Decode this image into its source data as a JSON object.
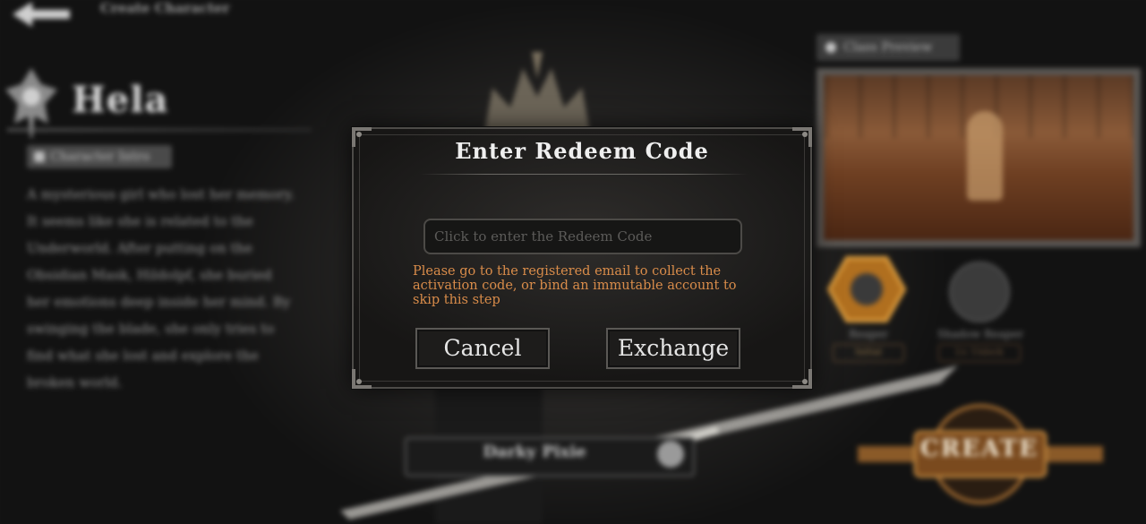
{
  "background": {
    "topbar_title": "Create Character",
    "character_name": "Hela",
    "intro_tab_label": "Character Intro",
    "description": "A mysterious girl who lost her memory. It seems like she is related to the Underworld. After putting on the Obsidian Mask, Hildolpf, she buried her emotions deep inside her mind. By swinging the blade, she only tries to find what she lost and explore the broken world.",
    "preview_tab_label": "Class Preview",
    "skills": [
      {
        "name": "Reaper",
        "tag": "Initial"
      },
      {
        "name": "Shadow Reaper",
        "tag": "Lv. Unlock"
      }
    ],
    "outfit_label": "Darky Pixie",
    "create_label": "CREATE"
  },
  "modal": {
    "title": "Enter Redeem Code",
    "input_placeholder": "Click to enter the Redeem Code",
    "input_value": "",
    "notice": "Please go to the registered email to collect the activation code, or bind an immutable account to skip this step",
    "cancel_label": "Cancel",
    "exchange_label": "Exchange"
  },
  "colors": {
    "notice_text": "#d98c4a",
    "modal_bg": "#1e1d1c",
    "modal_border": "#4d4b48"
  },
  "icons": [
    "back-arrow-icon",
    "character-emblem-icon",
    "crown-icon",
    "skill-icon",
    "create-emblem-icon"
  ]
}
